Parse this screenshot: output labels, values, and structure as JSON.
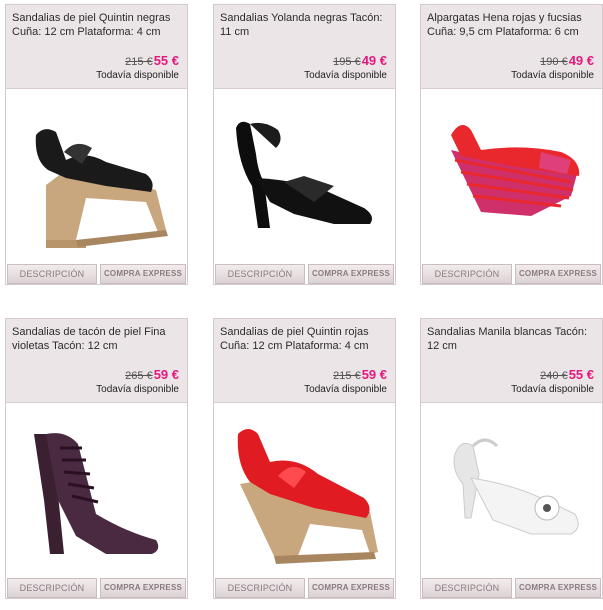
{
  "products": [
    {
      "title": "Sandalias de piel Quintin negras Cuña: 12 cm Plataforma: 4 cm",
      "old_price": "215 €",
      "new_price": "55 €",
      "availability": "Todavía disponible",
      "btn_desc": "DESCRIPCIÓN",
      "btn_express": "COMPRA EXPRESS",
      "shoe_color": "#1a1a1a",
      "sole_color": "#c9a77e"
    },
    {
      "title": "Sandalias Yolanda negras Tacón: 11 cm",
      "old_price": "195 €",
      "new_price": "49 €",
      "availability": "Todavía disponible",
      "btn_desc": "DESCRIPCIÓN",
      "btn_express": "COMPRA EXPRESS",
      "shoe_color": "#0d0d0d",
      "sole_color": "#0d0d0d"
    },
    {
      "title": "Alpargatas Hena rojas y fucsias Cuña: 9,5 cm Plataforma: 6 cm",
      "old_price": "190 €",
      "new_price": "49 €",
      "availability": "Todavía disponible",
      "btn_desc": "DESCRIPCIÓN",
      "btn_express": "COMPRA EXPRESS",
      "shoe_color": "#e8282c",
      "sole_color": "#d0306a"
    },
    {
      "title": "Sandalias de tacón de piel Fina violetas Tacón: 12 cm",
      "old_price": "265 €",
      "new_price": "59 €",
      "availability": "Todavía disponible",
      "btn_desc": "DESCRIPCIÓN",
      "btn_express": "COMPRA EXPRESS",
      "shoe_color": "#4a2a40",
      "sole_color": "#3a2030"
    },
    {
      "title": "Sandalias de piel Quintin rojas Cuña: 12 cm Plataforma: 4 cm",
      "old_price": "215 €",
      "new_price": "59 €",
      "availability": "Todavía disponible",
      "btn_desc": "DESCRIPCIÓN",
      "btn_express": "COMPRA EXPRESS",
      "shoe_color": "#e01c22",
      "sole_color": "#c9a77e"
    },
    {
      "title": "Sandalias Manila blancas Tacón: 12 cm",
      "old_price": "240 €",
      "new_price": "55 €",
      "availability": "Todavía disponible",
      "btn_desc": "DESCRIPCIÓN",
      "btn_express": "COMPRA EXPRESS",
      "shoe_color": "#f4f4f4",
      "sole_color": "#e6e6e6"
    }
  ]
}
